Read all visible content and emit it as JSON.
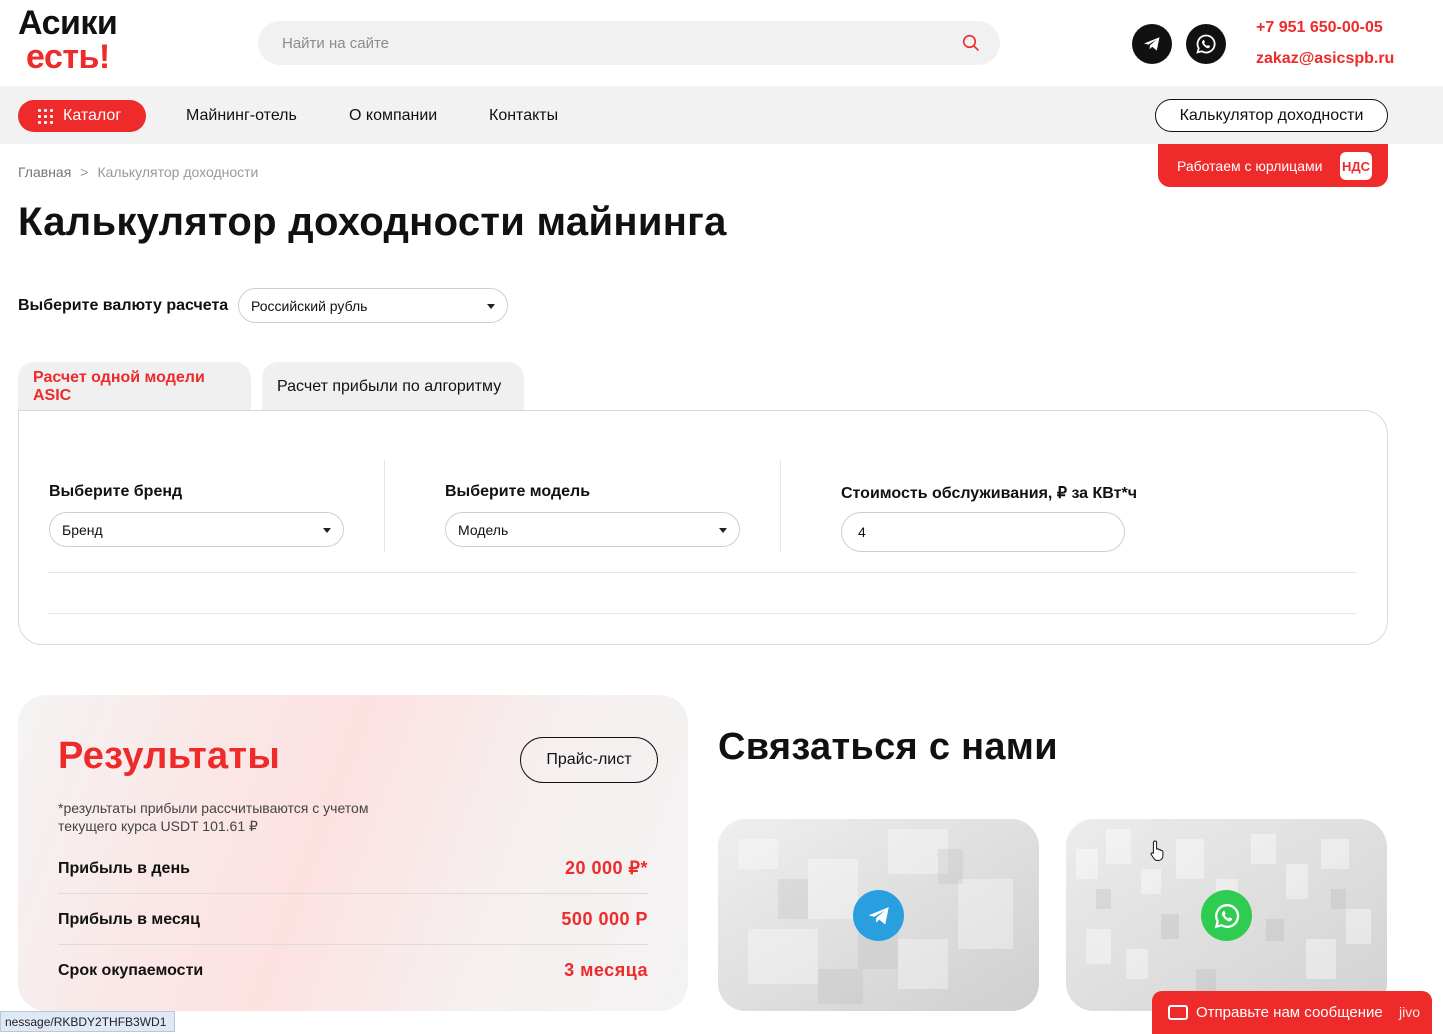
{
  "header": {
    "logo_line1": "Асики",
    "logo_line2": "есть!",
    "search_placeholder": "Найти на сайте",
    "phone": "+7 951 650-00-05",
    "email": "zakaz@asicspb.ru"
  },
  "nav": {
    "catalog_label": "Каталог",
    "links": [
      "Майнинг-отель",
      "О компании",
      "Контакты"
    ],
    "calculator_button": "Калькулятор доходности"
  },
  "legal_badge": {
    "text": "Работаем с юрлицами",
    "tag": "НДС"
  },
  "breadcrumb": {
    "home": "Главная",
    "separator": ">",
    "current": "Калькулятор доходности"
  },
  "page_title": "Калькулятор доходности майнинга",
  "currency": {
    "label": "Выберите валюту расчета",
    "selected": "Российский рубль"
  },
  "tabs": [
    {
      "label": "Расчет одной модели ASIC",
      "active": true
    },
    {
      "label": "Расчет прибыли по алгоритму",
      "active": false
    }
  ],
  "form": {
    "brand_label": "Выберите бренд",
    "brand_value": "Бренд",
    "model_label": "Выберите модель",
    "model_value": "Модель",
    "cost_label": "Стоимость обслуживания, ₽ за КВт*ч",
    "cost_value": "4"
  },
  "results": {
    "title": "Результаты",
    "price_list_button": "Прайс-лист",
    "note": "*результаты прибыли рассчитываются с учетом текущего курса USDT 101.61 ₽",
    "rows": [
      {
        "label": "Прибыль в день",
        "value": "20 000 ₽*"
      },
      {
        "label": "Прибыль в месяц",
        "value": "500 000 Р"
      },
      {
        "label": "Срок окупаемости",
        "value": "3 месяца"
      }
    ]
  },
  "contact": {
    "title": "Связаться с нами"
  },
  "chat_widget": {
    "text": "Отправьте нам сообщение",
    "brand": "jivo"
  },
  "status_bar": "nessage/RKBDY2THFB3WD1",
  "colors": {
    "accent": "#ee2a2a",
    "telegram": "#2a9fe0",
    "whatsapp": "#2fcc52"
  }
}
